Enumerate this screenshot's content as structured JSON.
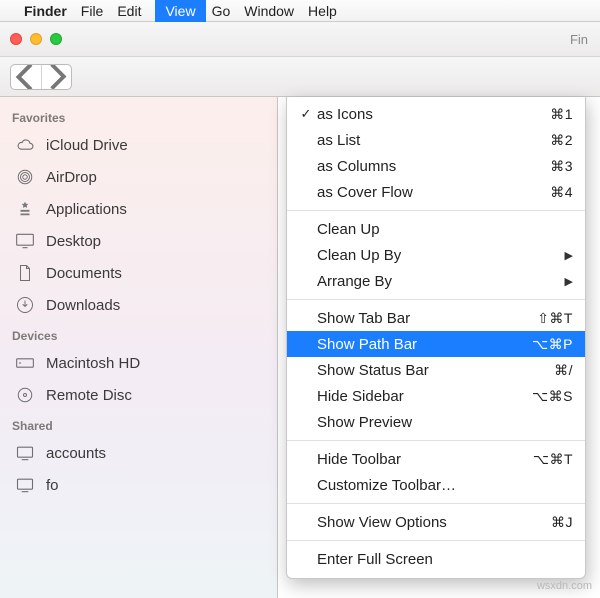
{
  "menubar": {
    "apple": "",
    "app": "Finder",
    "items": [
      "File",
      "Edit",
      "View",
      "Go",
      "Window",
      "Help"
    ],
    "active_index": 2
  },
  "titlebar": {
    "partial_right": "Fin"
  },
  "sidebar": {
    "sections": [
      {
        "title": "Favorites",
        "items": [
          {
            "icon": "cloud",
            "label": "iCloud Drive"
          },
          {
            "icon": "airdrop",
            "label": "AirDrop"
          },
          {
            "icon": "apps",
            "label": "Applications"
          },
          {
            "icon": "desktop",
            "label": "Desktop"
          },
          {
            "icon": "doc",
            "label": "Documents"
          },
          {
            "icon": "download",
            "label": "Downloads"
          }
        ]
      },
      {
        "title": "Devices",
        "items": [
          {
            "icon": "hd",
            "label": "Macintosh HD"
          },
          {
            "icon": "disc",
            "label": "Remote Disc"
          }
        ]
      },
      {
        "title": "Shared",
        "items": [
          {
            "icon": "server",
            "label": "accounts"
          },
          {
            "icon": "server",
            "label": "fo"
          }
        ]
      }
    ]
  },
  "dropdown": {
    "groups": [
      [
        {
          "check": true,
          "label": "as Icons",
          "shortcut": "⌘1"
        },
        {
          "check": false,
          "label": "as List",
          "shortcut": "⌘2"
        },
        {
          "check": false,
          "label": "as Columns",
          "shortcut": "⌘3"
        },
        {
          "check": false,
          "label": "as Cover Flow",
          "shortcut": "⌘4"
        }
      ],
      [
        {
          "label": "Clean Up"
        },
        {
          "label": "Clean Up By",
          "submenu": true
        },
        {
          "label": "Arrange By",
          "submenu": true
        }
      ],
      [
        {
          "label": "Show Tab Bar",
          "shortcut": "⇧⌘T"
        },
        {
          "label": "Show Path Bar",
          "shortcut": "⌥⌘P",
          "highlight": true
        },
        {
          "label": "Show Status Bar",
          "shortcut": "⌘/"
        },
        {
          "label": "Hide Sidebar",
          "shortcut": "⌥⌘S"
        },
        {
          "label": "Show Preview"
        }
      ],
      [
        {
          "label": "Hide Toolbar",
          "shortcut": "⌥⌘T"
        },
        {
          "label": "Customize Toolbar…"
        }
      ],
      [
        {
          "label": "Show View Options",
          "shortcut": "⌘J"
        }
      ],
      [
        {
          "label": "Enter Full Screen"
        }
      ]
    ]
  },
  "watermark": "wsxdn.com"
}
